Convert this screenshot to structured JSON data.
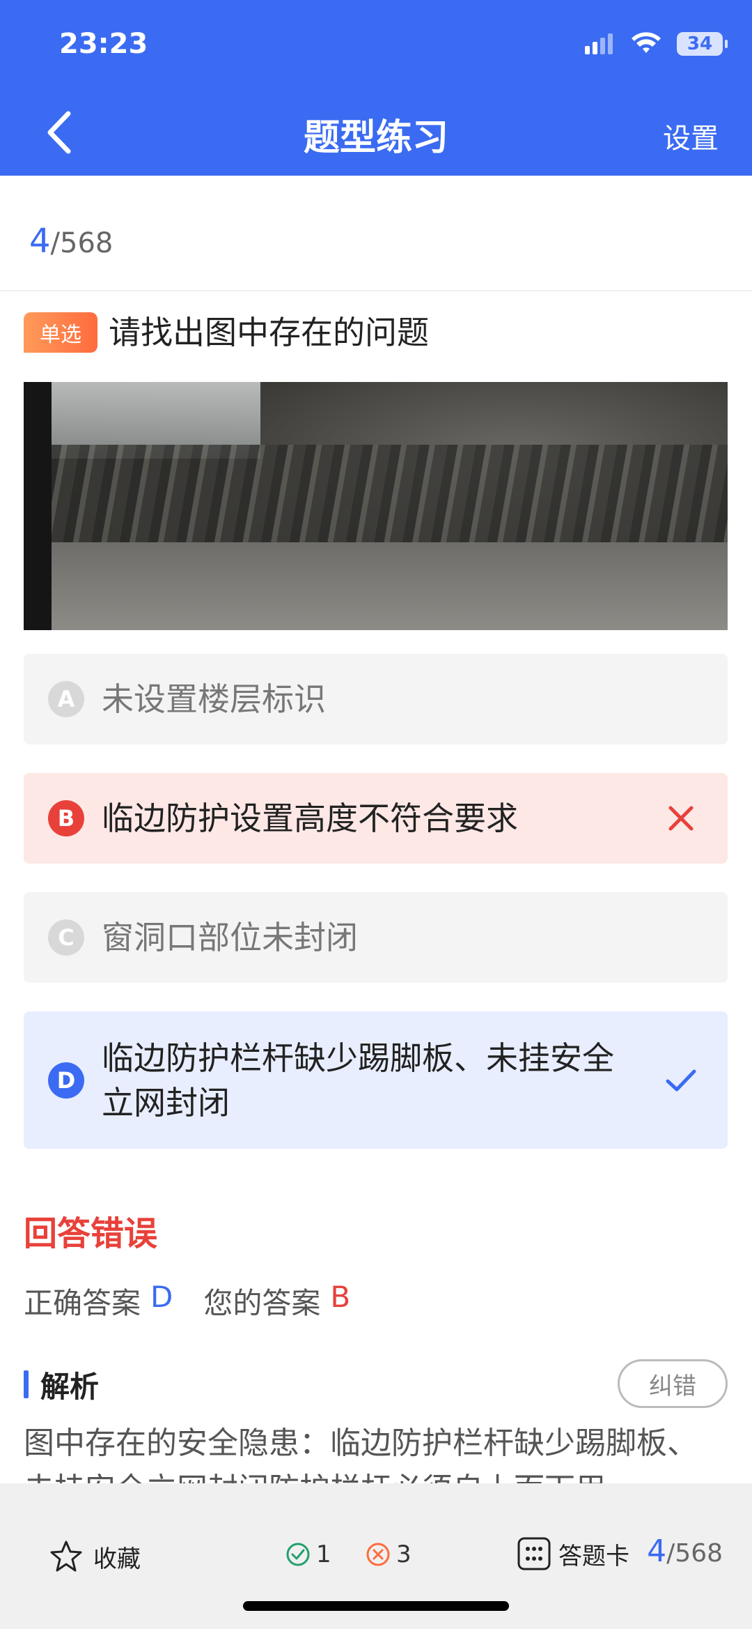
{
  "status_bar": {
    "time": "23:23",
    "battery": "34"
  },
  "nav": {
    "title": "题型练习",
    "settings_label": "设置"
  },
  "progress": {
    "current": "4",
    "total": "/568"
  },
  "question": {
    "type_badge": "单选",
    "text": "请找出图中存在的问题"
  },
  "options": [
    {
      "letter": "A",
      "text": "未设置楼层标识",
      "state": "neutral"
    },
    {
      "letter": "B",
      "text": "临边防护设置高度不符合要求",
      "state": "wrong"
    },
    {
      "letter": "C",
      "text": "窗洞口部位未封闭",
      "state": "neutral"
    },
    {
      "letter": "D",
      "text": "临边防护栏杆缺少踢脚板、未挂安全立网封闭",
      "state": "correct"
    }
  ],
  "result": {
    "title": "回答错误",
    "correct_label": "正确答案",
    "correct_value": "D",
    "yours_label": "您的答案",
    "yours_value": "B"
  },
  "analysis": {
    "title": "解析",
    "report_button": "纠错",
    "text": "图中存在的安全隐患：临边防护栏杆缺少踢脚板、未挂安全立网封闭防护栏杆必须自上而下用"
  },
  "bottom_bar": {
    "favorite_label": "收藏",
    "correct_count": "1",
    "wrong_count": "3",
    "answer_card_label": "答题卡",
    "progress_current": "4",
    "progress_total": "/568"
  },
  "colors": {
    "accent": "#3b6bf2",
    "error": "#e8413a",
    "success": "#22a06b",
    "badge": "#ff7a45"
  }
}
